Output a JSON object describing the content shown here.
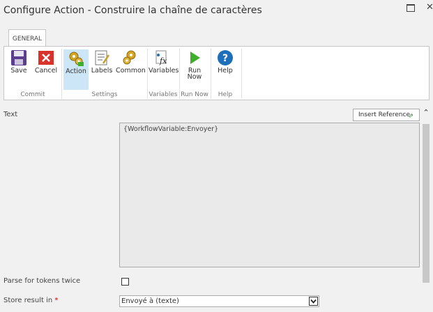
{
  "window": {
    "title": "Configure Action - Construire la chaîne de caractères",
    "maximize_icon": "maximize-icon",
    "close_icon": "close-icon",
    "close_glyph": "✕"
  },
  "ribbon": {
    "tabs": [
      {
        "label": "GENERAL",
        "active": true
      }
    ],
    "groups": {
      "commit": "Commit",
      "settings": "Settings",
      "variables": "Variables",
      "run_now": "Run Now",
      "help": "Help"
    },
    "buttons": {
      "save": "Save",
      "cancel": "Cancel",
      "action": "Action",
      "labels": "Labels",
      "common": "Common",
      "variables": "Variables",
      "run_now": "Run Now",
      "help": "Help"
    },
    "icons": [
      "save-icon",
      "cancel-icon",
      "action-icon",
      "labels-icon",
      "common-icon",
      "variables-icon",
      "run-now-icon",
      "help-icon"
    ]
  },
  "form": {
    "text_label": "Text",
    "insert_reference": "Insert Reference",
    "text_value": "{WorkflowVariable:Envoyer}",
    "parse_label": "Parse for tokens twice",
    "parse_checked": false,
    "store_label": "Store result in",
    "required_marker": "*",
    "store_value": "Envoyé à (texte)"
  },
  "colors": {
    "active_button_bg": "#cde6f7",
    "cancel_red": "#d9322a",
    "run_green": "#3fae2a",
    "help_blue": "#1c6fb8",
    "save_purple": "#5b3f8e"
  }
}
